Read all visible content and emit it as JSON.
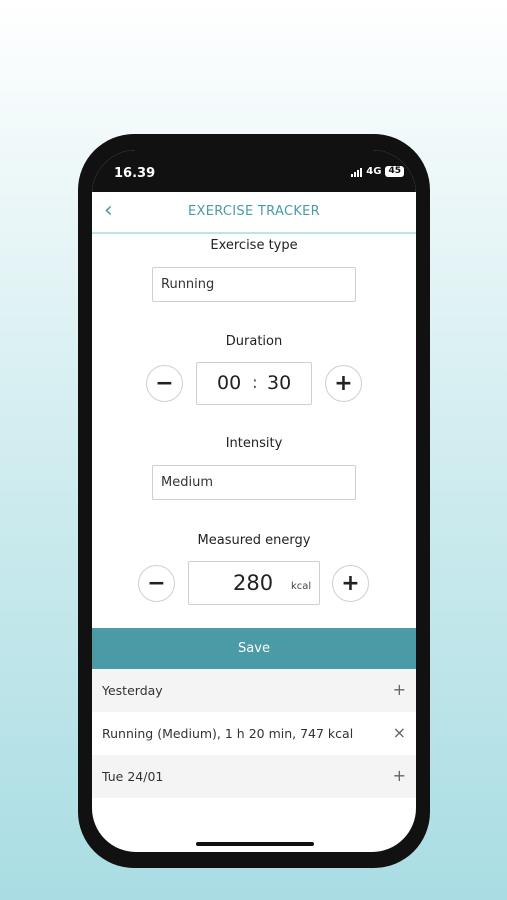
{
  "status": {
    "time": "16.39",
    "network": "4G",
    "battery": "45"
  },
  "header": {
    "title": "EXERCISE TRACKER"
  },
  "form": {
    "exercise_type_label": "Exercise type",
    "exercise_type_value": "Running",
    "duration_label": "Duration",
    "duration_hours": "00",
    "duration_separator": ":",
    "duration_minutes": "30",
    "intensity_label": "Intensity",
    "intensity_value": "Medium",
    "energy_label": "Measured energy",
    "energy_value": "280",
    "energy_unit": "kcal"
  },
  "save_label": "Save",
  "history": [
    {
      "text": "Yesterday",
      "action": "+"
    },
    {
      "text": "Running (Medium), 1 h 20 min, 747 kcal",
      "action": "×"
    },
    {
      "text": "Tue 24/01",
      "action": "+"
    }
  ],
  "colors": {
    "accent": "#4a9ba6",
    "accent_light": "#bfe3e6"
  }
}
